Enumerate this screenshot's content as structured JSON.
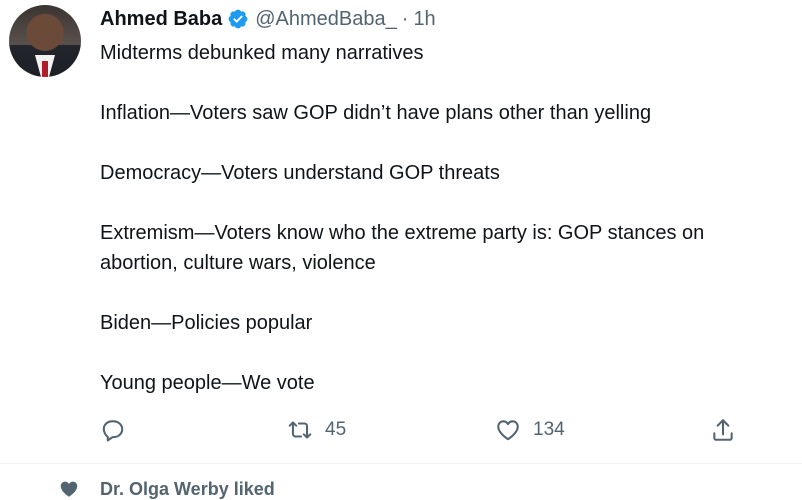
{
  "tweet": {
    "author_name": "Ahmed Baba",
    "handle": "@AhmedBaba_",
    "separator": "·",
    "time": "1h",
    "lines": [
      "Midterms debunked many narratives",
      "",
      "Inflation—Voters saw GOP didn’t have plans other than yelling",
      "",
      "Democracy—Voters understand GOP threats",
      "",
      "Extremism—Voters know who the extreme party is: GOP stances on",
      "abortion, culture wars, violence",
      "",
      "Biden—Policies popular",
      "",
      "Young people—We vote"
    ],
    "actions": {
      "reply_count": "",
      "retweet_count": "45",
      "like_count": "134"
    }
  },
  "next_item": {
    "liked_text": "Dr. Olga Werby liked"
  },
  "colors": {
    "text": "#0f1419",
    "secondary": "#536471",
    "verified": "#1d9bf0"
  },
  "icons": [
    "verified-badge-icon",
    "reply-icon",
    "retweet-icon",
    "like-icon",
    "share-icon",
    "heart-filled-icon"
  ]
}
